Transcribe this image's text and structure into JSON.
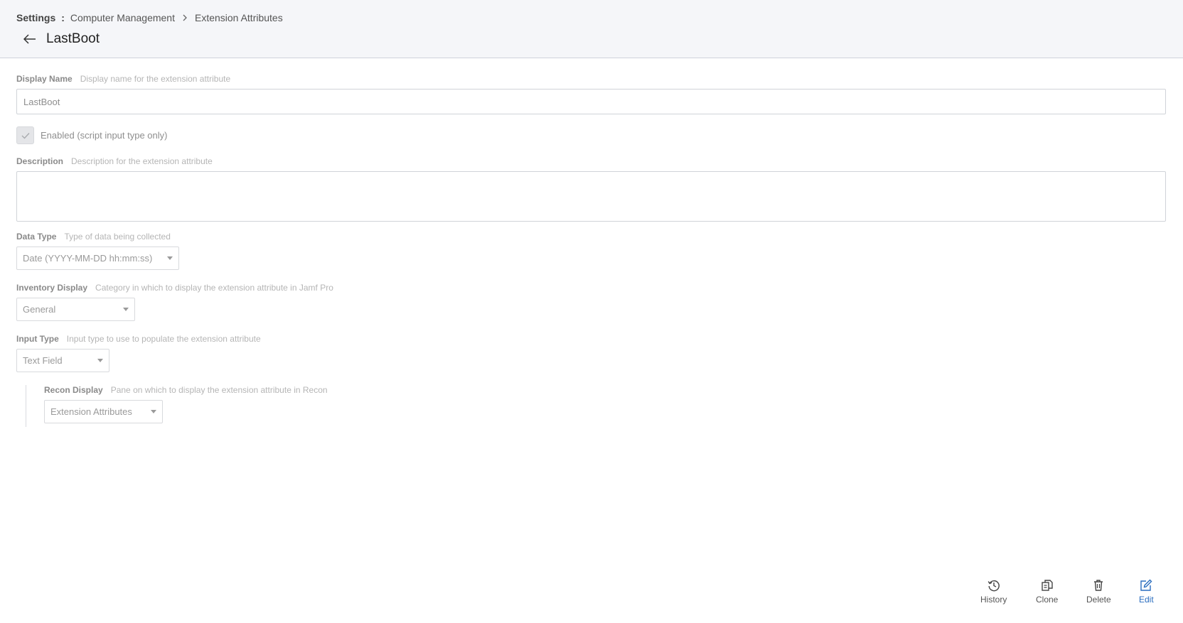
{
  "breadcrumb": {
    "root": "Settings",
    "separator": ":",
    "items": [
      "Computer Management",
      "Extension Attributes"
    ]
  },
  "header": {
    "title": "LastBoot",
    "back_icon": "arrow-left-icon"
  },
  "form": {
    "display_name": {
      "label": "Display Name",
      "hint": "Display name for the extension attribute",
      "value": "LastBoot"
    },
    "enabled": {
      "label": "Enabled (script input type only)",
      "checked": true
    },
    "description": {
      "label": "Description",
      "hint": "Description for the extension attribute",
      "value": ""
    },
    "data_type": {
      "label": "Data Type",
      "hint": "Type of data being collected",
      "value": "Date (YYYY-MM-DD hh:mm:ss)"
    },
    "inventory_display": {
      "label": "Inventory Display",
      "hint": "Category in which to display the extension attribute in Jamf Pro",
      "value": "General"
    },
    "input_type": {
      "label": "Input Type",
      "hint": "Input type to use to populate the extension attribute",
      "value": "Text Field"
    },
    "recon_display": {
      "label": "Recon Display",
      "hint": "Pane on which to display the extension attribute in Recon",
      "value": "Extension Attributes"
    }
  },
  "actions": {
    "history": {
      "label": "History",
      "icon": "history-icon"
    },
    "clone": {
      "label": "Clone",
      "icon": "clone-icon"
    },
    "delete": {
      "label": "Delete",
      "icon": "trash-icon"
    },
    "edit": {
      "label": "Edit",
      "icon": "edit-icon",
      "color": "#2a6dbf"
    }
  }
}
